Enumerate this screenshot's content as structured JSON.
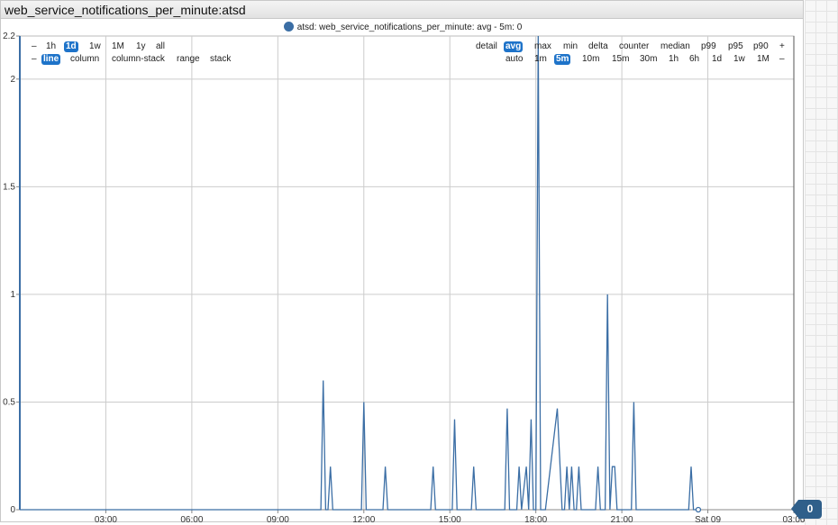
{
  "widget": {
    "title": "web_service_notifications_per_minute:atsd",
    "legend_label": "atsd: web_service_notifications_per_minute: avg - 5m: 0",
    "menu_icon": "hamburger-menu-icon",
    "badge_value": "0"
  },
  "controls": {
    "zoom": [
      {
        "label": "–",
        "active": false
      },
      {
        "label": "1h",
        "active": false
      },
      {
        "label": "1d",
        "active": true
      },
      {
        "label": "1w",
        "active": false
      },
      {
        "label": "1M",
        "active": false
      },
      {
        "label": "1y",
        "active": false
      },
      {
        "label": "all",
        "active": false
      }
    ],
    "chart_types": [
      {
        "label": "–",
        "active": false
      },
      {
        "label": "line",
        "active": true
      },
      {
        "label": "column",
        "active": false
      },
      {
        "label": "column-stack",
        "active": false
      },
      {
        "label": "range",
        "active": false
      },
      {
        "label": "stack",
        "active": false
      }
    ],
    "statistics": [
      {
        "label": "detail",
        "active": false
      },
      {
        "label": "avg",
        "active": true
      },
      {
        "label": "max",
        "active": false
      },
      {
        "label": "min",
        "active": false
      },
      {
        "label": "delta",
        "active": false
      },
      {
        "label": "counter",
        "active": false
      },
      {
        "label": "median",
        "active": false
      },
      {
        "label": "p99",
        "active": false
      },
      {
        "label": "p95",
        "active": false
      },
      {
        "label": "p90",
        "active": false
      },
      {
        "label": "+",
        "active": false
      }
    ],
    "periods": [
      {
        "label": "auto",
        "active": false
      },
      {
        "label": "1m",
        "active": false
      },
      {
        "label": "5m",
        "active": true
      },
      {
        "label": "10m",
        "active": false
      },
      {
        "label": "15m",
        "active": false
      },
      {
        "label": "30m",
        "active": false
      },
      {
        "label": "1h",
        "active": false
      },
      {
        "label": "6h",
        "active": false
      },
      {
        "label": "1d",
        "active": false
      },
      {
        "label": "1w",
        "active": false
      },
      {
        "label": "1M",
        "active": false
      },
      {
        "label": "–",
        "active": false
      }
    ]
  },
  "colors": {
    "series": "#3b6ea5",
    "grid": "#cccccc",
    "active_button": "#1e73c9"
  },
  "chart_data": {
    "type": "line",
    "series": [
      {
        "name": "atsd: web_service_notifications_per_minute: avg - 5m",
        "x": [
          "00:00",
          "10:30",
          "10:35",
          "10:40",
          "10:45",
          "10:50",
          "10:55",
          "11:55",
          "12:00",
          "12:05",
          "12:40",
          "12:45",
          "12:50",
          "14:20",
          "14:25",
          "14:30",
          "15:05",
          "15:10",
          "15:15",
          "15:45",
          "15:50",
          "15:55",
          "16:55",
          "17:00",
          "17:05",
          "17:20",
          "17:25",
          "17:30",
          "17:40",
          "17:45",
          "17:50",
          "17:55",
          "18:00",
          "18:05",
          "18:10",
          "18:15",
          "18:20",
          "18:45",
          "18:55",
          "19:00",
          "19:05",
          "19:10",
          "19:15",
          "19:20",
          "19:25",
          "19:30",
          "19:35",
          "20:05",
          "20:10",
          "20:15",
          "20:25",
          "20:30",
          "20:35",
          "20:40",
          "20:45",
          "20:50",
          "21:20",
          "21:25",
          "21:30",
          "23:20",
          "23:25",
          "23:30",
          "23:40"
        ],
        "values": [
          0,
          0,
          0.6,
          0,
          0,
          0.2,
          0,
          0,
          0.5,
          0,
          0,
          0.2,
          0,
          0,
          0.2,
          0,
          0,
          0.42,
          0,
          0,
          0.2,
          0,
          0,
          0.47,
          0,
          0,
          0.2,
          0,
          0.2,
          0,
          0.42,
          0,
          0,
          2.2,
          0,
          0,
          0,
          0.47,
          0,
          0,
          0.2,
          0,
          0.2,
          0,
          0,
          0.2,
          0,
          0,
          0.2,
          0,
          0,
          1,
          0,
          0.2,
          0.2,
          0,
          0,
          0.5,
          0,
          0,
          0.2,
          0,
          0
        ]
      }
    ],
    "x_tick_labels": [
      "03:00",
      "06:00",
      "09:00",
      "12:00",
      "15:00",
      "18:00",
      "21:00",
      "Sat 09",
      "03:00"
    ],
    "y_tick_labels": [
      "0",
      "0.5",
      "1",
      "1.5",
      "2",
      "2.2"
    ],
    "ylim": [
      0,
      2.2
    ],
    "xlim": [
      "00:00",
      "27:00"
    ],
    "grid": true,
    "legend_position": "top-center"
  }
}
